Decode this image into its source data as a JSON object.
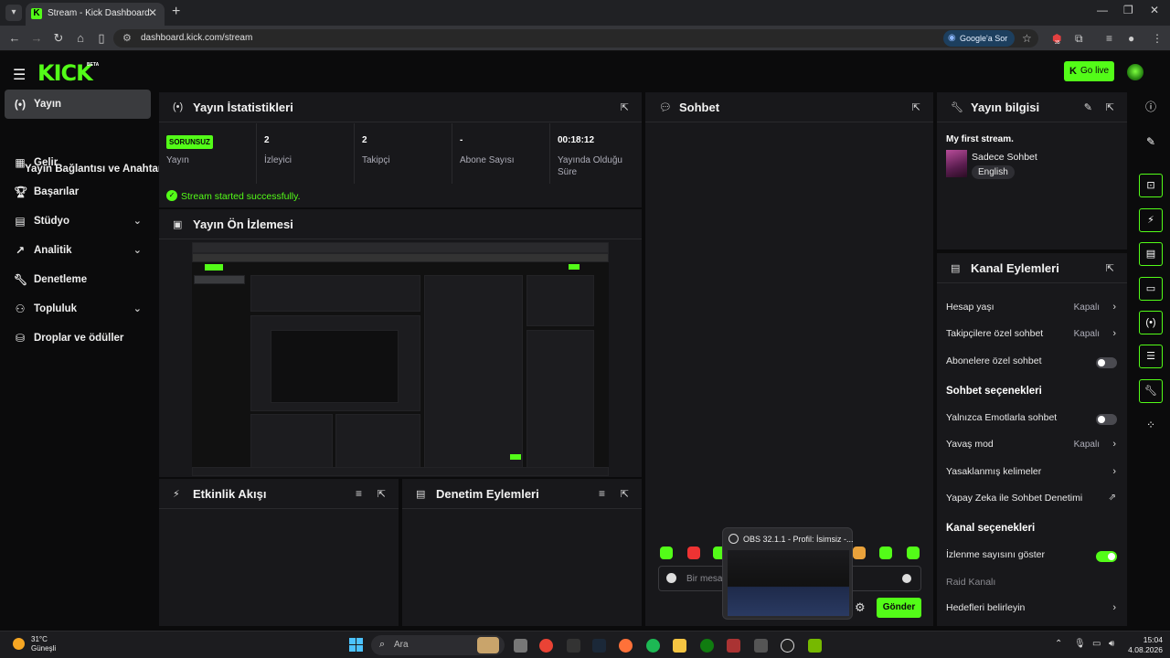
{
  "browser": {
    "tab_title": "Stream - Kick Dashboard",
    "url": "dashboard.kick.com/stream",
    "ask_google": "Google'a Sor",
    "extension_badge": "35"
  },
  "header": {
    "logo": "KICK",
    "logo_badge": "BETA",
    "go_live": "Go live"
  },
  "sidebar": {
    "items": [
      {
        "label": "Yayın",
        "icon": "broadcast-icon"
      },
      {
        "label": "Yayın Bağlantısı ve Anahtarı"
      },
      {
        "label": "Gelir",
        "icon": "revenue-icon"
      },
      {
        "label": "Başarılar",
        "icon": "trophy-icon"
      },
      {
        "label": "Stüdyo",
        "icon": "studio-icon"
      },
      {
        "label": "Analitik",
        "icon": "analytics-icon"
      },
      {
        "label": "Denetleme",
        "icon": "wrench-icon"
      },
      {
        "label": "Topluluk",
        "icon": "community-icon"
      },
      {
        "label": "Droplar ve ödüller",
        "icon": "drops-icon"
      }
    ]
  },
  "stats": {
    "title": "Yayın İstatistikleri",
    "status_badge": "SORUNSUZ",
    "status_label": "Yayın",
    "viewers_value": "2",
    "viewers_label": "İzleyici",
    "followers_value": "2",
    "followers_label": "Takipçi",
    "subs_value": "-",
    "subs_label": "Abone Sayısı",
    "duration_value": "00:18:12",
    "duration_label": "Yayında Olduğu Süre",
    "success_message": "Stream started successfully."
  },
  "preview": {
    "title": "Yayın Ön İzlemesi"
  },
  "activity": {
    "title": "Etkinlik Akışı"
  },
  "mod_actions": {
    "title": "Denetim Eylemleri"
  },
  "chat": {
    "title": "Sohbet",
    "input_placeholder": "Bir mesaj gönderin",
    "send": "Gönder"
  },
  "obs_popup": {
    "title": "OBS 32.1.1 - Profil: İsimsiz -..."
  },
  "stream_info": {
    "title": "Yayın bilgisi",
    "stream_title": "My first stream.",
    "category": "Sadece Sohbet",
    "language": "English"
  },
  "channel_actions": {
    "title": "Kanal Eylemleri",
    "account_age": "Hesap yaşı",
    "account_age_value": "Kapalı",
    "followers_only": "Takipçilere özel sohbet",
    "followers_only_value": "Kapalı",
    "subs_only": "Abonelere özel sohbet",
    "chat_options_heading": "Sohbet seçenekleri",
    "emotes_only": "Yalnızca Emotlarla sohbet",
    "slow_mode": "Yavaş mod",
    "slow_mode_value": "Kapalı",
    "banned_words": "Yasaklanmış kelimeler",
    "ai_moderation": "Yapay Zeka ile Sohbet Denetimi",
    "channel_options_heading": "Kanal seçenekleri",
    "show_viewer_count": "İzlenme sayısını göster",
    "raid_channel": "Raid Kanalı",
    "set_goals": "Hedefleri belirleyin"
  },
  "taskbar": {
    "temperature": "31°C",
    "weather": "Güneşli",
    "search_placeholder": "Ara",
    "time": "15:04",
    "date": "4.08.2026"
  },
  "colors": {
    "accent": "#53fc18",
    "panel": "#18181b",
    "background": "#0b0b0c"
  }
}
